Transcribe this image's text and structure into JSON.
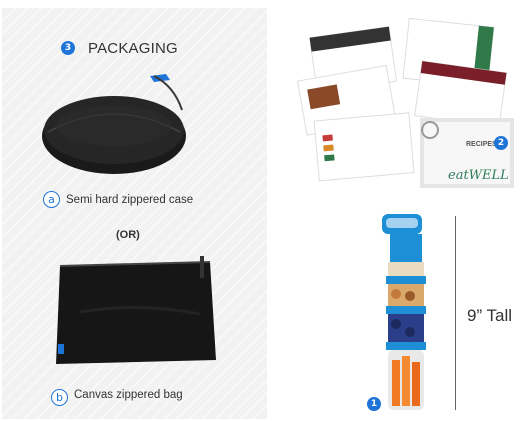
{
  "packaging": {
    "step_number": "3",
    "heading": "PACKAGING",
    "option_a": {
      "letter": "a",
      "caption": "Semi hard zippered case"
    },
    "or_label": "(OR)",
    "option_b": {
      "letter": "b",
      "caption": "Canvas zippered bag"
    }
  },
  "cards": {
    "badge_number": "2",
    "logo_text": "eatWELL",
    "label_text": "RECIPES"
  },
  "jars": {
    "badge_number": "1",
    "size_label": "9” Tall"
  },
  "colors": {
    "accent_blue": "#1f74d8",
    "jar_blue": "#1d8fd6",
    "panel_gray": "#f2f2f2"
  }
}
